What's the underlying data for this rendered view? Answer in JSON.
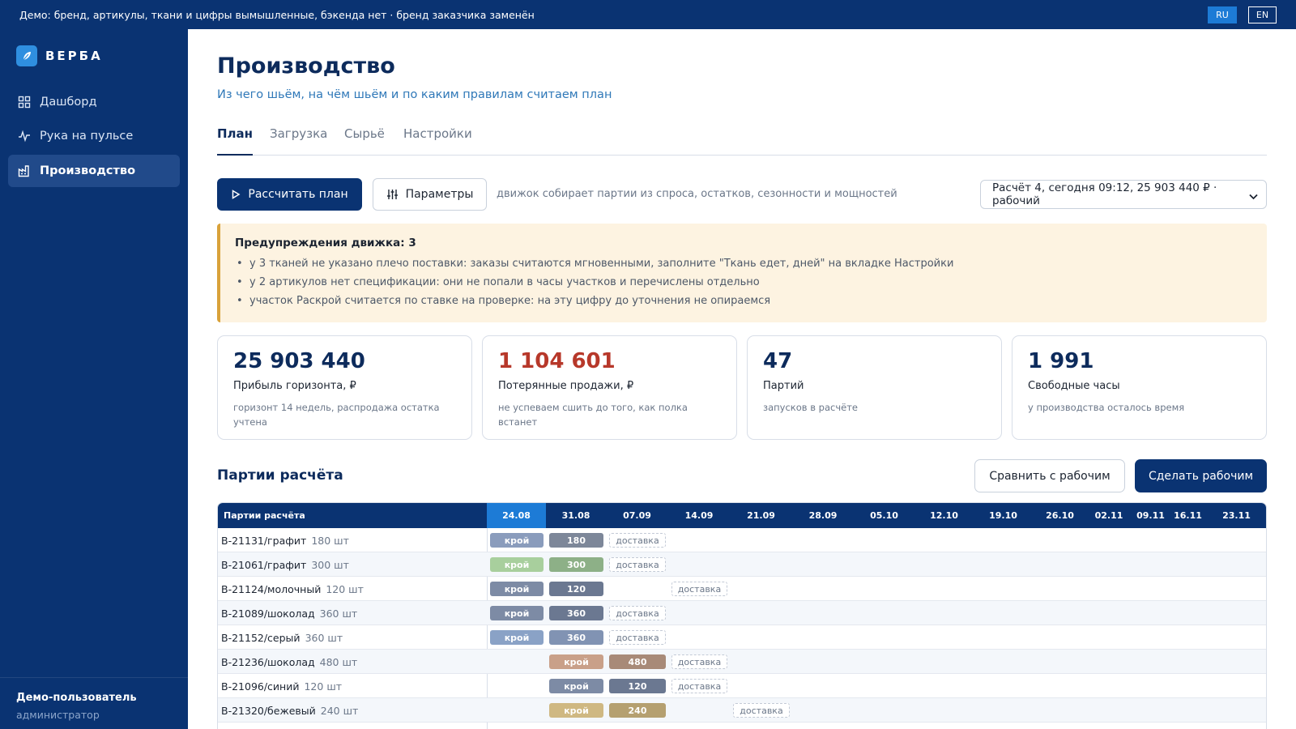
{
  "banner": {
    "text": "Демо: бренд, артикулы, ткани и цифры вымышленные, бэкенда нет · бренд заказчика заменён",
    "lang_ru": "RU",
    "lang_en": "EN"
  },
  "brand": {
    "name": "ВЕРБА",
    "icon": "leaf-icon"
  },
  "sidebar": {
    "items": [
      {
        "label": "Дашборд",
        "icon": "dashboard-grid-icon"
      },
      {
        "label": "Рука на пульсе",
        "icon": "pulse-icon"
      },
      {
        "label": "Производство",
        "icon": "factory-icon",
        "active": true
      }
    ],
    "user": {
      "name": "Демо-пользователь",
      "role": "администратор"
    }
  },
  "page": {
    "title": "Производство",
    "subtitle": "Из чего шьём, на чём шьём и по каким правилам считаем план"
  },
  "tabs": [
    {
      "label": "План",
      "active": true
    },
    {
      "label": "Загрузка"
    },
    {
      "label": "Сырьё"
    },
    {
      "label": "Настройки"
    }
  ],
  "toolbar": {
    "calc_button": "Рассчитать план",
    "params_button": "Параметры",
    "note": "движок собирает партии из спроса, остатков, сезонности и мощностей",
    "selected_calc": "Расчёт 4, сегодня 09:12, 25 903 440 ₽ · рабочий"
  },
  "warnings": {
    "title": "Предупреждения движка: 3",
    "items": [
      "у 3 тканей не указано плечо поставки: заказы считаются мгновенными, заполните \"Ткань едет, дней\" на вкладке Настройки",
      "у 2 артикулов нет спецификации: они не попали в часы участков и перечислены отдельно",
      "участок Раскрой считается по ставке на проверке: на эту цифру до уточнения не опираемся"
    ]
  },
  "kpis": [
    {
      "value": "25 903 440",
      "label": "Прибыль горизонта, ₽",
      "note": "горизонт 14 недель, распродажа остатка учтена",
      "color": "#0d2b5c"
    },
    {
      "value": "1 104 601",
      "label": "Потерянные продажи, ₽",
      "note": "не успеваем сшить до того, как полка встанет",
      "color": "#b7382a"
    },
    {
      "value": "47",
      "label": "Партий",
      "note": "запусков в расчёте",
      "color": "#0d2b5c"
    },
    {
      "value": "1 991",
      "label": "Свободные часы",
      "note": "у производства осталось время",
      "color": "#0d2b5c"
    }
  ],
  "batches": {
    "title": "Партии расчёта",
    "compare_button": "Сравнить с рабочим",
    "make_button": "Сделать рабочим",
    "header_label": "Партии расчёта",
    "weeks": [
      "24.08",
      "31.08",
      "07.09",
      "14.09",
      "21.09",
      "28.09",
      "05.10",
      "12.10",
      "19.10",
      "26.10",
      "02.11",
      "09.11",
      "16.11",
      "23.11"
    ],
    "current_week": 0,
    "cut_label": "крой",
    "delivery_label": "доставка",
    "rows": [
      {
        "sku": "В-21131/графит",
        "qty": "180 шт",
        "units": "180",
        "cut_week": 0,
        "sew_week": 1,
        "delivery_week": 2,
        "cut_color": "#8a9cbc",
        "sew_color": "#7d8799"
      },
      {
        "sku": "В-21061/графит",
        "qty": "300 шт",
        "units": "300",
        "cut_week": 0,
        "sew_week": 1,
        "delivery_week": 2,
        "cut_color": "#a8cf9d",
        "sew_color": "#8db087"
      },
      {
        "sku": "В-21124/молочный",
        "qty": "120 шт",
        "units": "120",
        "cut_week": 0,
        "sew_week": 1,
        "delivery_week": 3,
        "cut_color": "#7d8ba5",
        "sew_color": "#6b7891"
      },
      {
        "sku": "В-21089/шоколад",
        "qty": "360 шт",
        "units": "360",
        "cut_week": 0,
        "sew_week": 1,
        "delivery_week": 2,
        "cut_color": "#7d8ba5",
        "sew_color": "#6b7891"
      },
      {
        "sku": "В-21152/серый",
        "qty": "360 шт",
        "units": "360",
        "cut_week": 0,
        "sew_week": 1,
        "delivery_week": 2,
        "cut_color": "#8aa2c6",
        "sew_color": "#8193b3"
      },
      {
        "sku": "В-21236/шоколад",
        "qty": "480 шт",
        "units": "480",
        "cut_week": 1,
        "sew_week": 2,
        "delivery_week": 3,
        "cut_color": "#c9a089",
        "sew_color": "#a88a78"
      },
      {
        "sku": "В-21096/синий",
        "qty": "120 шт",
        "units": "120",
        "cut_week": 1,
        "sew_week": 2,
        "delivery_week": 3,
        "cut_color": "#7d8ba5",
        "sew_color": "#6b7891"
      },
      {
        "sku": "В-21320/бежевый",
        "qty": "240 шт",
        "units": "240",
        "cut_week": 1,
        "sew_week": 2,
        "delivery_week": 4,
        "cut_color": "#cfb882",
        "sew_color": "#b5a070"
      }
    ]
  }
}
